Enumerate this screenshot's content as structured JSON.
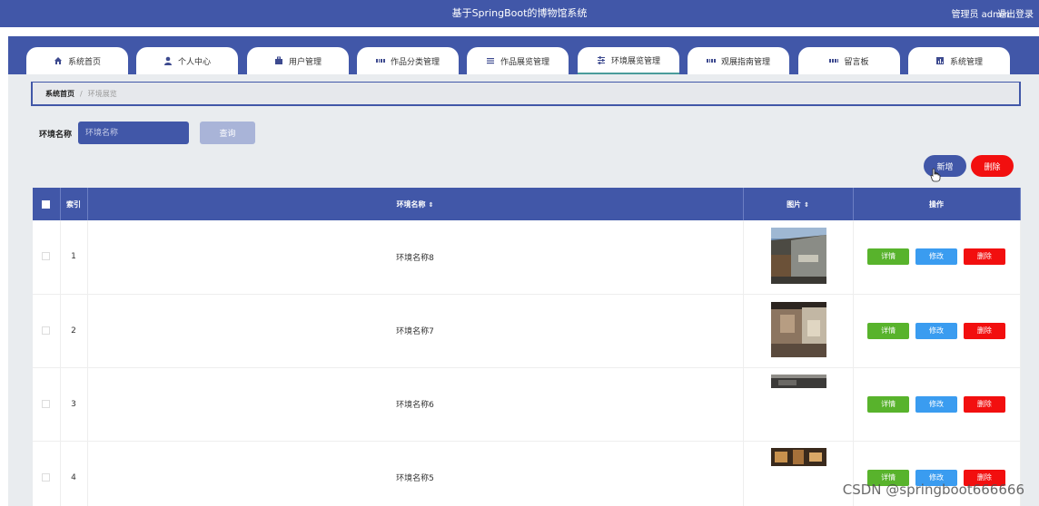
{
  "header": {
    "title": "基于SpringBoot的博物馆系统",
    "user": "管理员 admin",
    "logout": "退出登录"
  },
  "nav": {
    "tabs": [
      {
        "label": "系统首页",
        "icon": "home-icon"
      },
      {
        "label": "个人中心",
        "icon": "user-icon"
      },
      {
        "label": "用户管理",
        "icon": "briefcase-icon"
      },
      {
        "label": "作品分类管理",
        "icon": "grid-icon"
      },
      {
        "label": "作品展览管理",
        "icon": "list-icon"
      },
      {
        "label": "环境展览管理",
        "icon": "sliders-icon",
        "active": true
      },
      {
        "label": "观展指南管理",
        "icon": "grid-icon"
      },
      {
        "label": "留言板",
        "icon": "grid-icon"
      },
      {
        "label": "系统管理",
        "icon": "chart-icon"
      }
    ]
  },
  "breadcrumb": {
    "home": "系统首页",
    "current": "环境展览"
  },
  "search": {
    "label": "环境名称",
    "placeholder": "环境名称",
    "button": "查询"
  },
  "actions": {
    "add": "新增",
    "delete": "删除"
  },
  "table": {
    "headers": {
      "index": "索引",
      "name": "环境名称",
      "image": "图片",
      "operation": "操作"
    },
    "rows": [
      {
        "index": "1",
        "name": "环境名称8"
      },
      {
        "index": "2",
        "name": "环境名称7"
      },
      {
        "index": "3",
        "name": "环境名称6"
      },
      {
        "index": "4",
        "name": "环境名称5"
      }
    ],
    "row_buttons": {
      "detail": "详情",
      "edit": "修改",
      "remove": "删除"
    }
  },
  "watermark": "CSDN @springboot666666",
  "colors": {
    "primary": "#4157a8",
    "danger": "#f20f0f",
    "success": "#58b32c",
    "info": "#3a9cf0",
    "background": "#e9ecef"
  }
}
